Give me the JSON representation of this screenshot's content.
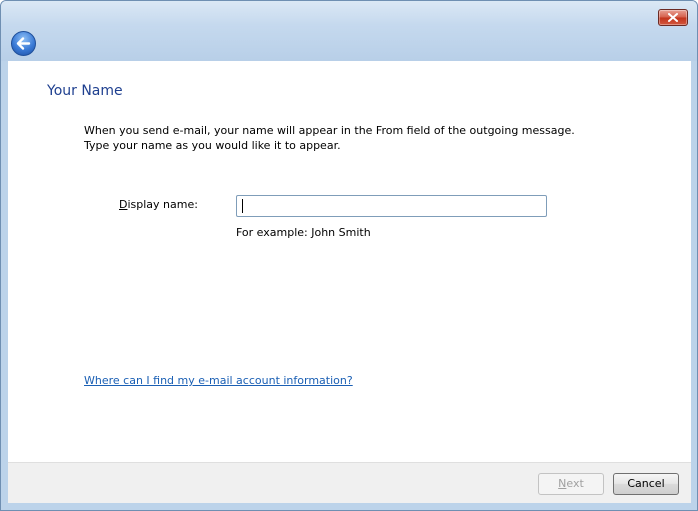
{
  "window": {
    "close_icon": "close-icon",
    "back_icon": "back-arrow-icon"
  },
  "page": {
    "heading": "Your Name",
    "description_line1": "When you send e-mail, your name will appear in the From field of the outgoing message.",
    "description_line2": "Type your name as you would like it to appear."
  },
  "form": {
    "display_name_label_accel": "D",
    "display_name_label_rest": "isplay name:",
    "display_name_value": "",
    "example_text": "For example: John Smith"
  },
  "help_link": "Where can I find my e-mail account information?",
  "buttons": {
    "next_accel": "N",
    "next_rest": "ext",
    "next_enabled": false,
    "cancel_label": "Cancel"
  },
  "colors": {
    "heading": "#1e3f8f",
    "link": "#1a5fb4",
    "frame": "#bcd3ea"
  }
}
